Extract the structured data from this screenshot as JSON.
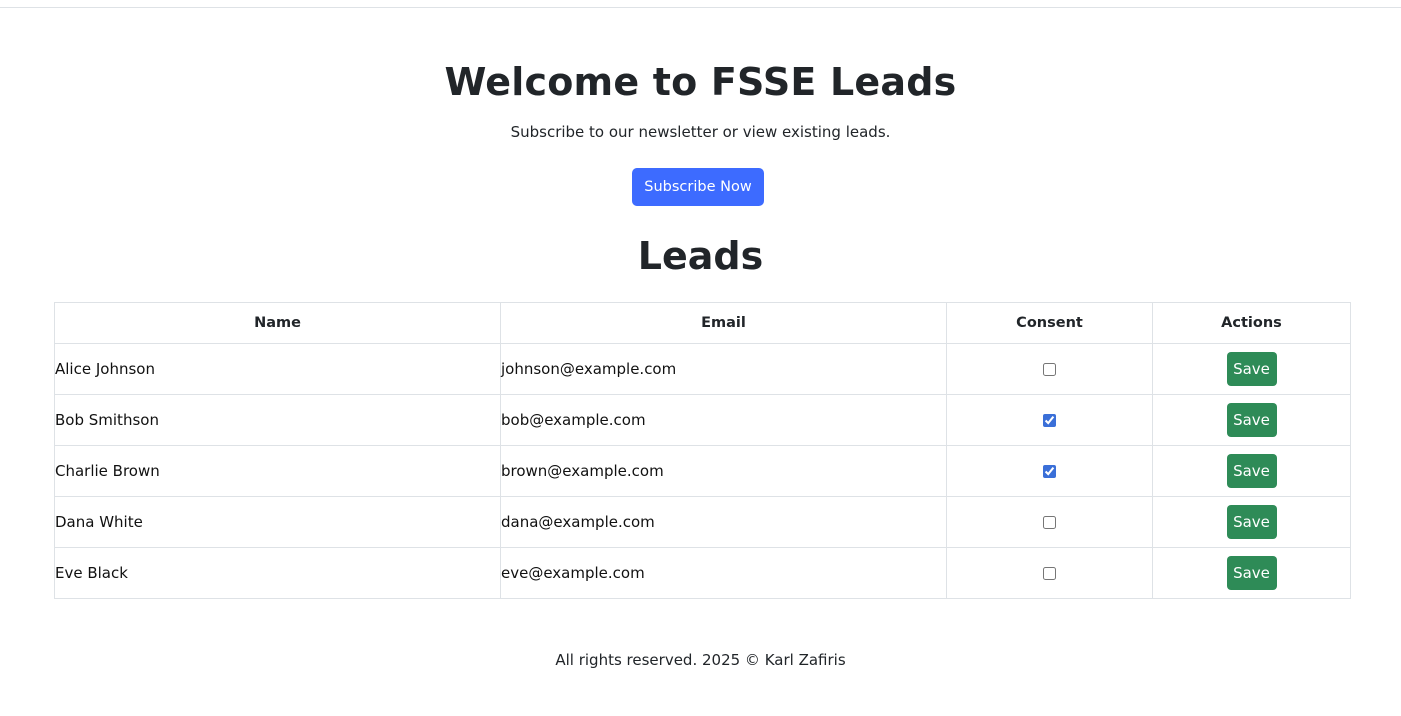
{
  "header": {
    "title": "Welcome to FSSE Leads",
    "subtitle": "Subscribe to our newsletter or view existing leads.",
    "subscribe_label": "Subscribe Now"
  },
  "leads": {
    "title": "Leads",
    "columns": [
      "Name",
      "Email",
      "Consent",
      "Actions"
    ],
    "rows": [
      {
        "name": "Alice Johnson",
        "email": "johnson@example.com",
        "consent": false,
        "action": "Save"
      },
      {
        "name": "Bob Smithson",
        "email": "bob@example.com",
        "consent": true,
        "action": "Save"
      },
      {
        "name": "Charlie Brown",
        "email": "brown@example.com",
        "consent": true,
        "action": "Save"
      },
      {
        "name": "Dana White",
        "email": "dana@example.com",
        "consent": false,
        "action": "Save"
      },
      {
        "name": "Eve Black",
        "email": "eve@example.com",
        "consent": false,
        "action": "Save"
      }
    ]
  },
  "footer": {
    "text": "All rights reserved. 2025 © Karl Zafiris"
  },
  "colors": {
    "primary": "#3d6bff",
    "success": "#2e8b57",
    "border": "#dee2e6",
    "text": "#212529"
  }
}
